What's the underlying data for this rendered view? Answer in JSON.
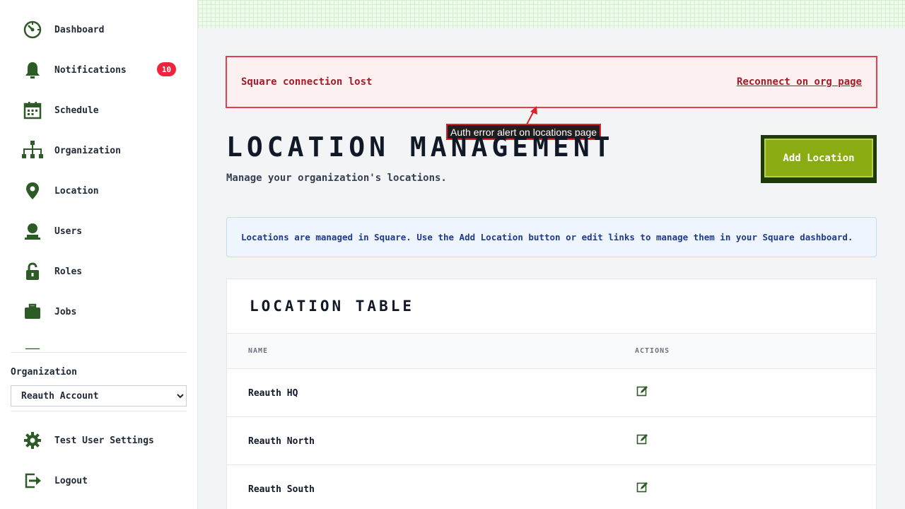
{
  "sidebar": {
    "nav": [
      {
        "label": "Dashboard",
        "icon": "dashboard-icon"
      },
      {
        "label": "Notifications",
        "icon": "bell-icon",
        "badge": "10"
      },
      {
        "label": "Schedule",
        "icon": "calendar-icon"
      },
      {
        "label": "Organization",
        "icon": "org-chart-icon"
      },
      {
        "label": "Location",
        "icon": "map-pin-icon"
      },
      {
        "label": "Users",
        "icon": "user-icon"
      },
      {
        "label": "Roles",
        "icon": "unlock-icon"
      },
      {
        "label": "Jobs",
        "icon": "briefcase-icon"
      }
    ],
    "org_label": "Organization",
    "org_selected": "Reauth Account",
    "footer": [
      {
        "label": "Test User Settings",
        "icon": "gear-icon"
      },
      {
        "label": "Logout",
        "icon": "logout-icon"
      }
    ]
  },
  "alert": {
    "message": "Square connection lost",
    "link": "Reconnect on org page",
    "annotation": "Auth error alert on locations page"
  },
  "header": {
    "title": "Location Management",
    "subtitle": "Manage your organization's locations.",
    "add_button": "Add Location"
  },
  "info": {
    "text": "Locations are managed in Square. Use the Add Location button or edit links to manage them in your Square dashboard."
  },
  "table": {
    "title": "Location Table",
    "columns": [
      "Name",
      "Actions"
    ],
    "rows": [
      {
        "name": "Reauth HQ"
      },
      {
        "name": "Reauth North"
      },
      {
        "name": "Reauth South"
      }
    ]
  },
  "colors": {
    "sidebar_icon": "#2d5a27",
    "badge": "#ef233c",
    "error": "#a61b29",
    "primary_button": "#8aab12",
    "info_text": "#1e3a8a"
  }
}
